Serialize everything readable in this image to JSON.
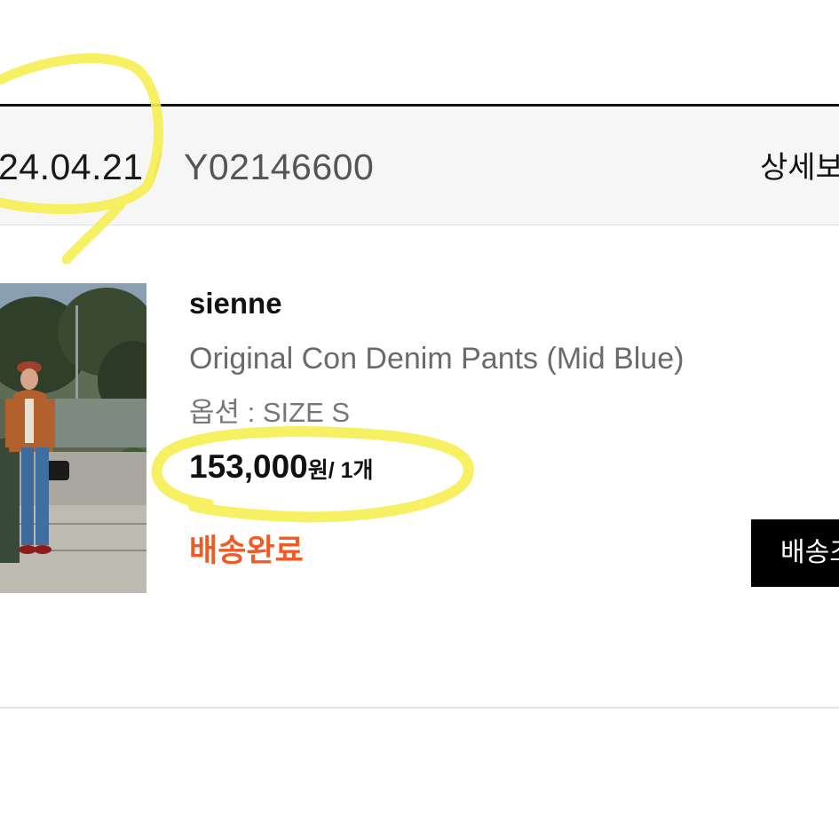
{
  "order": {
    "date": "24.04.21",
    "separator": "/",
    "number": "Y02146600",
    "detail_link": "상세보"
  },
  "product": {
    "brand": "sienne",
    "name": "Original Con Denim Pants (Mid Blue)",
    "option": "옵션 : SIZE S",
    "price": "153,000",
    "price_unit": "원",
    "quantity": "/ 1개",
    "status": "배송완료",
    "action_button": "배송조"
  },
  "colors": {
    "status": "#f15a22",
    "highlight": "#f7ee52",
    "button_bg": "#000000"
  },
  "icons": {
    "highlight_marks": "yellow-marker-circle"
  }
}
